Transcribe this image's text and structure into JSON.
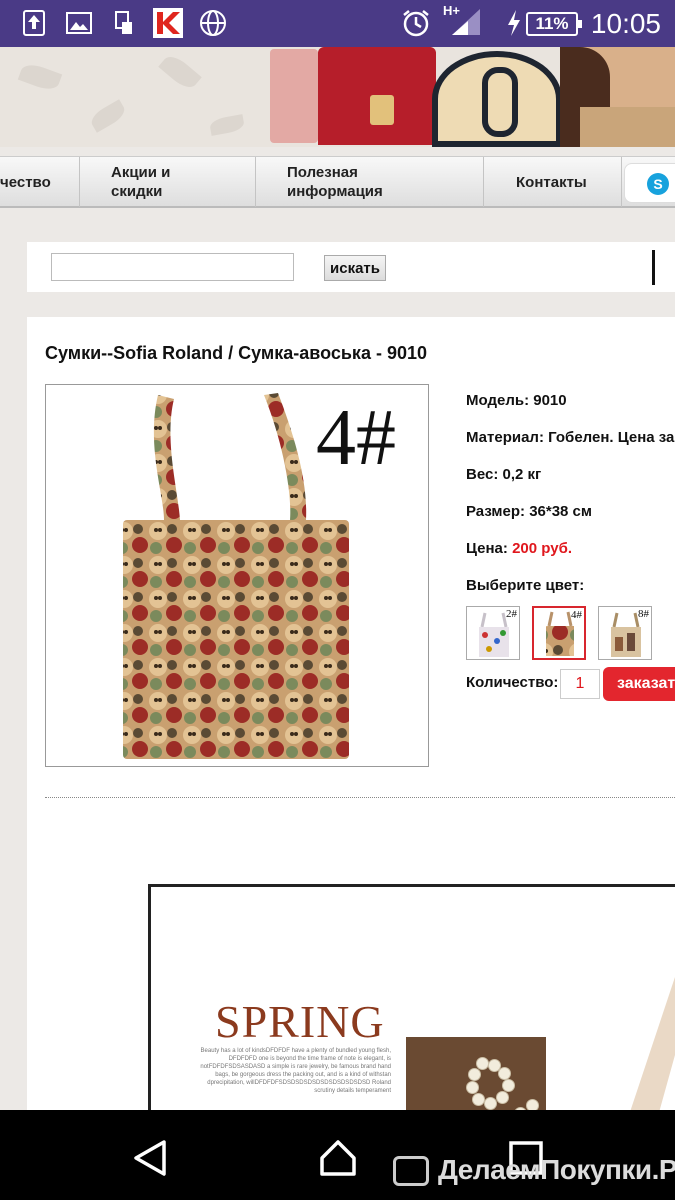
{
  "status_bar": {
    "network": "H+",
    "battery": "11%",
    "time": "10:05"
  },
  "nav": {
    "items": [
      {
        "label": "чество"
      },
      {
        "label": "Акции и скидки"
      },
      {
        "label": "Полезная информация"
      },
      {
        "label": "Контакты"
      }
    ],
    "skype_icon": "skype-icon"
  },
  "search": {
    "value": "",
    "button": "искать"
  },
  "product": {
    "title": "Сумки--Sofia Roland / Сумка-авоська - 9010",
    "image_label": "4#",
    "model_label": "Модель:",
    "model": "9010",
    "material_label": "Материал:",
    "material": "Гобелен. Цена за",
    "weight_label": "Вес:",
    "weight": "0,2 кг",
    "size_label": "Размер:",
    "size": "36*38 см",
    "price_label": "Цена:",
    "price": "200 руб.",
    "color_label": "Выберите цвет:",
    "colors": [
      {
        "label": "2#",
        "selected": false
      },
      {
        "label": "4#",
        "selected": true
      },
      {
        "label": "8#",
        "selected": false
      }
    ],
    "qty_label": "Количество:",
    "qty": "1",
    "order_button": "заказать"
  },
  "promo": {
    "heading": "SPRING",
    "text": "Beauty has a lot of kindsDFDFDF have a plenty of bundled young flesh, DFDFDFD one is beyond the time frame of note is elegant, is notFDFDFSDSASDASD a simple is rare jewelry, be famous brand hand bags, be gorgeous dress the packing out, and is a kind of withstan dprecipitation, willDFDFDFSDSDSDSDSDSDSDSDSDSDSD Roland scrutiny details temperament"
  },
  "watermark": "ДелаемПокупки.Ру",
  "colors": {
    "status_bar": "#4a3a86",
    "accent_red": "#e3262e",
    "price_red": "#e0171d"
  }
}
